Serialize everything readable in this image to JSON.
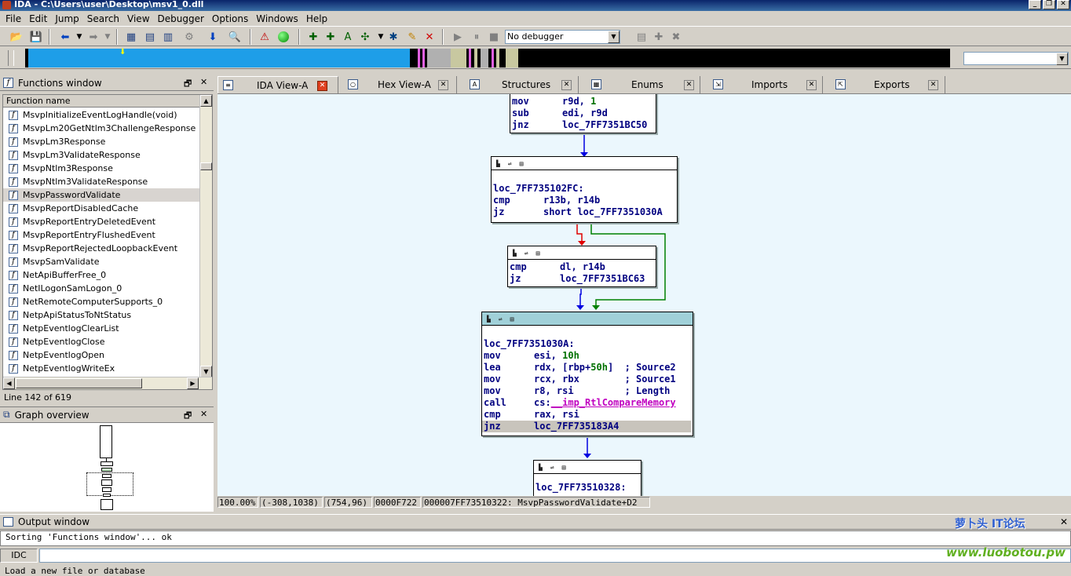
{
  "title": "IDA - C:\\Users\\user\\Desktop\\msv1_0.dll",
  "menu": [
    "File",
    "Edit",
    "Jump",
    "Search",
    "View",
    "Debugger",
    "Options",
    "Windows",
    "Help"
  ],
  "debugger_select": "No debugger",
  "functions_panel": {
    "title": "Functions window",
    "column": "Function name",
    "items": [
      "MsvpInitializeEventLogHandle(void)",
      "MsvpLm20GetNtlm3ChallengeResponse",
      "MsvpLm3Response",
      "MsvpLm3ValidateResponse",
      "MsvpNtlm3Response",
      "MsvpNtlm3ValidateResponse",
      "MsvpPasswordValidate",
      "MsvpReportDisabledCache",
      "MsvpReportEntryDeletedEvent",
      "MsvpReportEntryFlushedEvent",
      "MsvpReportRejectedLoopbackEvent",
      "MsvpSamValidate",
      "NetApiBufferFree_0",
      "NetILogonSamLogon_0",
      "NetRemoteComputerSupports_0",
      "NetpApiStatusToNtStatus",
      "NetpEventlogClearList",
      "NetpEventlogClose",
      "NetpEventlogOpen",
      "NetpEventlogWriteEx"
    ],
    "selected_index": 6,
    "line_status": "Line 142 of 619"
  },
  "graph_overview": {
    "title": "Graph overview"
  },
  "tabs": [
    {
      "label": "IDA View-A",
      "active": true
    },
    {
      "label": "Hex View-A"
    },
    {
      "label": "Structures"
    },
    {
      "label": "Enums"
    },
    {
      "label": "Imports"
    },
    {
      "label": "Exports"
    }
  ],
  "blocks": {
    "b1": {
      "lines": [
        {
          "op": "mov",
          "args": "r9d, ",
          "num": "1"
        },
        {
          "op": "sub",
          "args": "edi, r9d"
        },
        {
          "op": "jnz",
          "args": "loc_7FF7351BC50"
        }
      ]
    },
    "b2": {
      "label": "loc_7FF735102FC:",
      "lines": [
        {
          "op": "cmp",
          "args": "r13b, r14b"
        },
        {
          "op": "jz",
          "args": "short loc_7FF7351030A"
        }
      ]
    },
    "b3": {
      "lines": [
        {
          "op": "cmp",
          "args": "dl, r14b"
        },
        {
          "op": "jz",
          "args": "loc_7FF7351BC63"
        }
      ]
    },
    "b4": {
      "label": "loc_7FF7351030A:",
      "lines": [
        {
          "op": "mov",
          "args": "esi, ",
          "num": "10h"
        },
        {
          "op": "lea",
          "args": "rdx, [rbp+",
          "num": "50h",
          "tail": "]  ",
          "comment": "; Source2"
        },
        {
          "op": "mov",
          "args": "rcx, rbx        ",
          "comment": "; Source1"
        },
        {
          "op": "mov",
          "args": "r8, rsi         ",
          "comment": "; Length"
        },
        {
          "op": "call",
          "args": "cs:",
          "sym": "__imp_RtlCompareMemory"
        },
        {
          "op": "cmp",
          "args": "rax, rsi"
        },
        {
          "op": "jnz",
          "args": "loc_7FF735183A4"
        }
      ]
    },
    "b5": {
      "label": "loc_7FF73510328:"
    }
  },
  "status": {
    "zoom": "100.00%",
    "cursor": "(-308,1038)",
    "pos": "(754,96)",
    "offset": "0000F722",
    "location": "000007FF73510322: MsvpPasswordValidate+D2"
  },
  "output": {
    "title": "Output window",
    "text": "Sorting 'Functions window'... ok",
    "idc_label": "IDC",
    "hint": "Load a new file or database"
  },
  "watermark": {
    "top": "萝卜头 IT论坛",
    "bottom": "www.luobotou.pw"
  }
}
